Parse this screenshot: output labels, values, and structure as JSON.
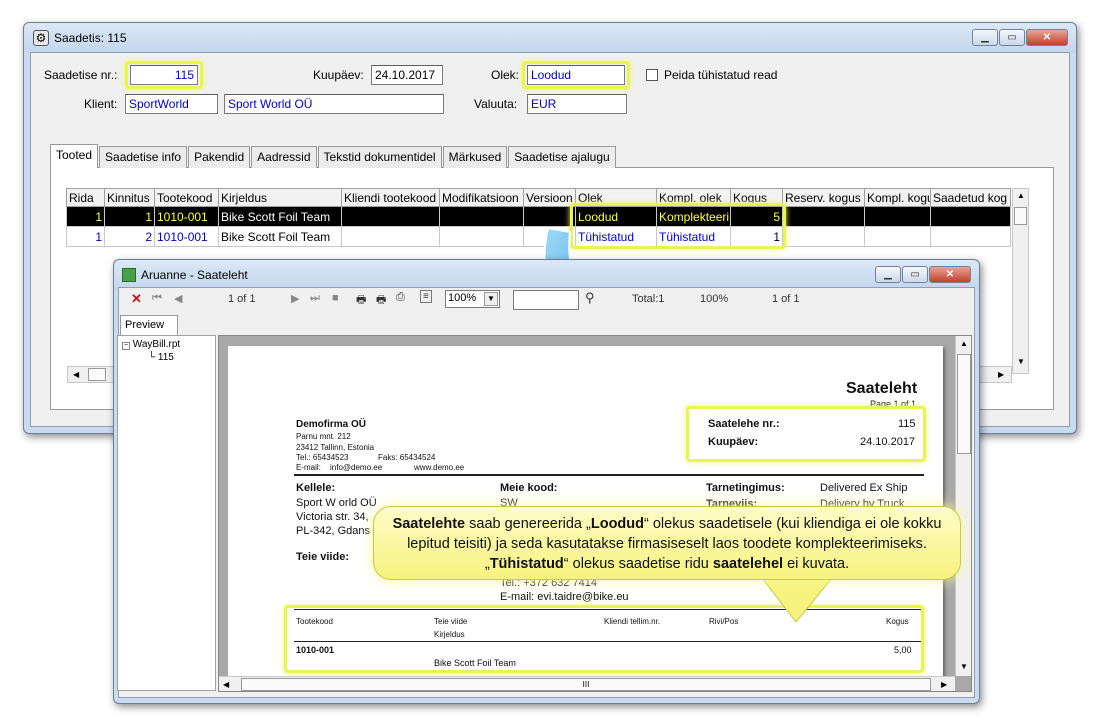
{
  "main_window": {
    "title": "Saadetis: 115",
    "fields": {
      "saadetise_nr_label": "Saadetise nr.:",
      "saadetise_nr_value": "115",
      "kuupaev_label": "Kuupäev:",
      "kuupaev_value": "24.10.2017",
      "olek_label": "Olek:",
      "olek_value": "Loodud",
      "peida_label": "Peida tühistatud read",
      "klient_label": "Klient:",
      "klient_code": "SportWorld",
      "klient_name": "Sport World OÜ",
      "valuuta_label": "Valuuta:",
      "valuuta_value": "EUR"
    },
    "tabs": [
      "Tooted",
      "Saadetise info",
      "Pakendid",
      "Aadressid",
      "Tekstid dokumentidel",
      "Märkused",
      "Saadetise ajalugu"
    ],
    "grid": {
      "columns": [
        "Rida",
        "Kinnitus",
        "Tootekood",
        "Kirjeldus",
        "Kliendi tootekood",
        "Modifikatsioon",
        "Versioon",
        "Olek",
        "Kompl. olek",
        "Kogus",
        "Reserv. kogus",
        "Kompl. kogus",
        "Saadetud kog"
      ],
      "rows": [
        {
          "rida": "1",
          "kinnitus": "1",
          "tootekood": "1010-001",
          "kirjeldus": "Bike Scott Foil Team",
          "olek": "Loodud",
          "kompl_olek": "Komplekteeri",
          "kogus": "5"
        },
        {
          "rida": "1",
          "kinnitus": "2",
          "tootekood": "1010-001",
          "kirjeldus": "Bike Scott Foil Team",
          "olek": "Tühistatud",
          "kompl_olek": "Tühistatud",
          "kogus": "1"
        }
      ]
    }
  },
  "report_window": {
    "title": "Aruanne - Saateleht",
    "toolbar": {
      "page_of": "1 of 1",
      "zoom": "100%",
      "total": "Total:1",
      "zoom_readout": "100%",
      "page_readout": "1 of 1"
    },
    "tab_label": "Preview",
    "tree": {
      "root": "WayBill.rpt",
      "child": "115"
    },
    "document": {
      "title": "Saateleht",
      "page": "Page 1 of 1",
      "company": "Demofirma OÜ",
      "address1": "Parnu mnt. 212",
      "address2": "23412 Tallinn, Estonia",
      "tel": "Tel.: 65434523",
      "faks": "Faks: 65434524",
      "email_label": "E-mail:",
      "email": "info@demo.ee",
      "web": "www.demo.ee",
      "saatelehe_nr_label": "Saatelehe nr.:",
      "saatelehe_nr": "115",
      "kuupaev_label": "Kuupäev:",
      "kuupaev": "24.10.2017",
      "kellele_label": "Kellele:",
      "kellele_1": "Sport W orld OÜ",
      "kellele_2": "Victoria str. 34,",
      "kellele_3": "PL-342, Gdans",
      "meie_kood_label": "Meie kood:",
      "meie_kood": "SW",
      "tarnetingimus_label": "Tarnetingimus:",
      "tarnetingimus": "Delivered Ex Ship",
      "tarneviis_label": "Tarneviis:",
      "tarneviis": "Delivery by Truck",
      "teie_viide_label": "Teie viide:",
      "tel2": "Tel.: +372 632 7414",
      "email2": "E-mail: evi.taidre@bike.eu",
      "table_headers": [
        "Tootekood",
        "Teie viide",
        "Kliendi tellim.nr.",
        "Rivi/Pos",
        "Kogus"
      ],
      "table_sub": "Kirjeldus",
      "line_code": "1010-001",
      "line_qty": "5,00",
      "line_desc": "Bike Scott Foil Team"
    },
    "hscroll_mark": "III"
  },
  "callout": {
    "part1": "Saatelehte",
    "part2": " saab genereerida „",
    "part3": "Loodud",
    "part4": "“ olekus saadetisele (kui kliendiga ei ole kokku lepitud teisiti) ja seda kasutatakse firmasiseselt laos toodete komplekteerimiseks. „",
    "part5": "Tühistatud",
    "part6": "“ olekus saadetise ridu ",
    "part7": "saatelehel",
    "part8": " ei kuvata."
  },
  "colors": {
    "highlight": "#e8f54a",
    "field_text": "#0000c8",
    "arrow": "#2ea7e6"
  }
}
